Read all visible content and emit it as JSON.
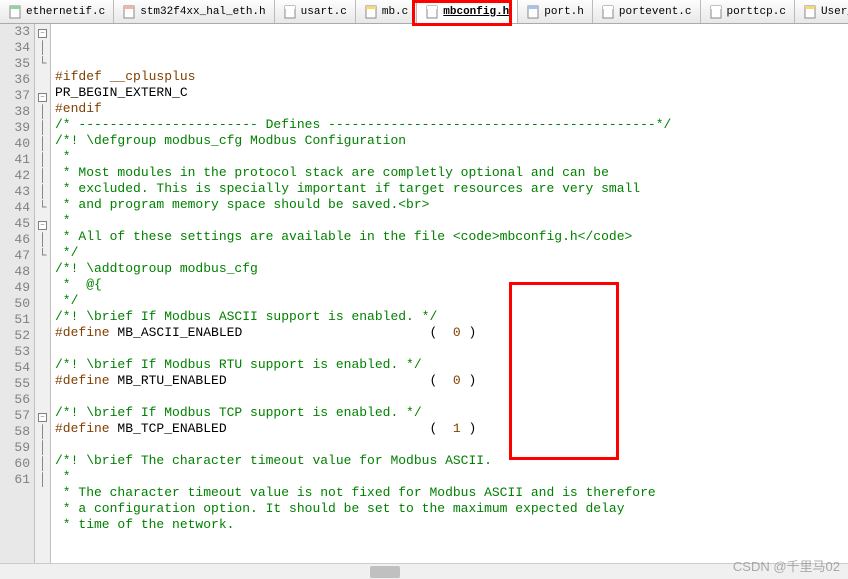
{
  "tabs": [
    {
      "label": "ethernetif.c",
      "color_strip": "#8fd4a0"
    },
    {
      "label": "stm32f4xx_hal_eth.h",
      "color_strip": "#f4b4a0"
    },
    {
      "label": "usart.c",
      "color_strip": "#ffffff"
    },
    {
      "label": "mb.c",
      "color_strip": "#f5d873"
    },
    {
      "label": "mbconfig.h",
      "color_strip": "#ffffff",
      "active": true
    },
    {
      "label": "port.h",
      "color_strip": "#a3c4e8"
    },
    {
      "label": "portevent.c",
      "color_strip": "#ffffff"
    },
    {
      "label": "porttcp.c",
      "color_strip": "#ffffff"
    },
    {
      "label": "User_m",
      "color_strip": "#f5d873"
    }
  ],
  "active_tab_index": 4,
  "line_start": 33,
  "lines": [
    {
      "n": 33,
      "fold": "minus",
      "seg": [
        {
          "t": "#ifdef __cplusplus",
          "c": "brown"
        }
      ]
    },
    {
      "n": 34,
      "fold": "pipe",
      "seg": [
        {
          "t": "PR_BEGIN_EXTERN_C",
          "c": "black"
        }
      ]
    },
    {
      "n": 35,
      "fold": "end",
      "seg": [
        {
          "t": "#endif",
          "c": "brown"
        }
      ]
    },
    {
      "n": 36,
      "fold": "",
      "seg": [
        {
          "t": "/* ----------------------- Defines ------------------------------------------*/",
          "c": "green"
        }
      ]
    },
    {
      "n": 37,
      "fold": "minus",
      "seg": [
        {
          "t": "/*! \\defgroup modbus_cfg Modbus Configuration",
          "c": "green"
        }
      ]
    },
    {
      "n": 38,
      "fold": "pipe",
      "seg": [
        {
          "t": " *",
          "c": "green"
        }
      ]
    },
    {
      "n": 39,
      "fold": "pipe",
      "seg": [
        {
          "t": " * Most modules in the protocol stack are completly optional and can be",
          "c": "green"
        }
      ]
    },
    {
      "n": 40,
      "fold": "pipe",
      "seg": [
        {
          "t": " * excluded. This is specially important if target resources are very small",
          "c": "green"
        }
      ]
    },
    {
      "n": 41,
      "fold": "pipe",
      "seg": [
        {
          "t": " * and program memory space should be saved.<br>",
          "c": "green"
        }
      ]
    },
    {
      "n": 42,
      "fold": "pipe",
      "seg": [
        {
          "t": " *",
          "c": "green"
        }
      ]
    },
    {
      "n": 43,
      "fold": "pipe",
      "seg": [
        {
          "t": " * All of these settings are available in the file <code>mbconfig.h</code>",
          "c": "green"
        }
      ]
    },
    {
      "n": 44,
      "fold": "end",
      "seg": [
        {
          "t": " */",
          "c": "green"
        }
      ]
    },
    {
      "n": 45,
      "fold": "minus",
      "seg": [
        {
          "t": "/*! \\addtogroup modbus_cfg",
          "c": "green"
        }
      ]
    },
    {
      "n": 46,
      "fold": "pipe",
      "seg": [
        {
          "t": " *  @{",
          "c": "green"
        }
      ]
    },
    {
      "n": 47,
      "fold": "end",
      "seg": [
        {
          "t": " */",
          "c": "green"
        }
      ]
    },
    {
      "n": 48,
      "fold": "",
      "seg": [
        {
          "t": "/*! \\brief If Modbus ASCII support is enabled. */",
          "c": "green"
        }
      ]
    },
    {
      "n": 49,
      "fold": "",
      "seg": [
        {
          "t": "#define ",
          "c": "brown"
        },
        {
          "t": "MB_ASCII_ENABLED                        ",
          "c": "black"
        },
        {
          "t": "(  ",
          "c": "black"
        },
        {
          "t": "0",
          "c": "brown"
        },
        {
          "t": " )",
          "c": "black"
        }
      ]
    },
    {
      "n": 50,
      "fold": "",
      "seg": [
        {
          "t": "",
          "c": "black"
        }
      ]
    },
    {
      "n": 51,
      "fold": "",
      "seg": [
        {
          "t": "/*! \\brief If Modbus RTU support is enabled. */",
          "c": "green"
        }
      ]
    },
    {
      "n": 52,
      "fold": "",
      "seg": [
        {
          "t": "#define ",
          "c": "brown"
        },
        {
          "t": "MB_RTU_ENABLED                          ",
          "c": "black"
        },
        {
          "t": "(  ",
          "c": "black"
        },
        {
          "t": "0",
          "c": "brown"
        },
        {
          "t": " )",
          "c": "black"
        }
      ]
    },
    {
      "n": 53,
      "fold": "",
      "seg": [
        {
          "t": "",
          "c": "black"
        }
      ]
    },
    {
      "n": 54,
      "fold": "",
      "seg": [
        {
          "t": "/*! \\brief If Modbus TCP support is enabled. */",
          "c": "green"
        }
      ]
    },
    {
      "n": 55,
      "fold": "",
      "seg": [
        {
          "t": "#define ",
          "c": "brown"
        },
        {
          "t": "MB_TCP_ENABLED                          ",
          "c": "black"
        },
        {
          "t": "(  ",
          "c": "black"
        },
        {
          "t": "1",
          "c": "brown"
        },
        {
          "t": " )",
          "c": "black"
        }
      ]
    },
    {
      "n": 56,
      "fold": "",
      "seg": [
        {
          "t": "",
          "c": "black"
        }
      ]
    },
    {
      "n": 57,
      "fold": "minus",
      "seg": [
        {
          "t": "/*! \\brief The character timeout value for Modbus ASCII.",
          "c": "green"
        }
      ]
    },
    {
      "n": 58,
      "fold": "pipe",
      "seg": [
        {
          "t": " *",
          "c": "green"
        }
      ]
    },
    {
      "n": 59,
      "fold": "pipe",
      "seg": [
        {
          "t": " * The character timeout value is not fixed for Modbus ASCII and is therefore",
          "c": "green"
        }
      ]
    },
    {
      "n": 60,
      "fold": "pipe",
      "seg": [
        {
          "t": " * a configuration option. It should be set to the maximum expected delay",
          "c": "green"
        }
      ]
    },
    {
      "n": 61,
      "fold": "pipe",
      "seg": [
        {
          "t": " * time of the network.",
          "c": "green"
        }
      ]
    }
  ],
  "watermark": "CSDN @千里马02"
}
